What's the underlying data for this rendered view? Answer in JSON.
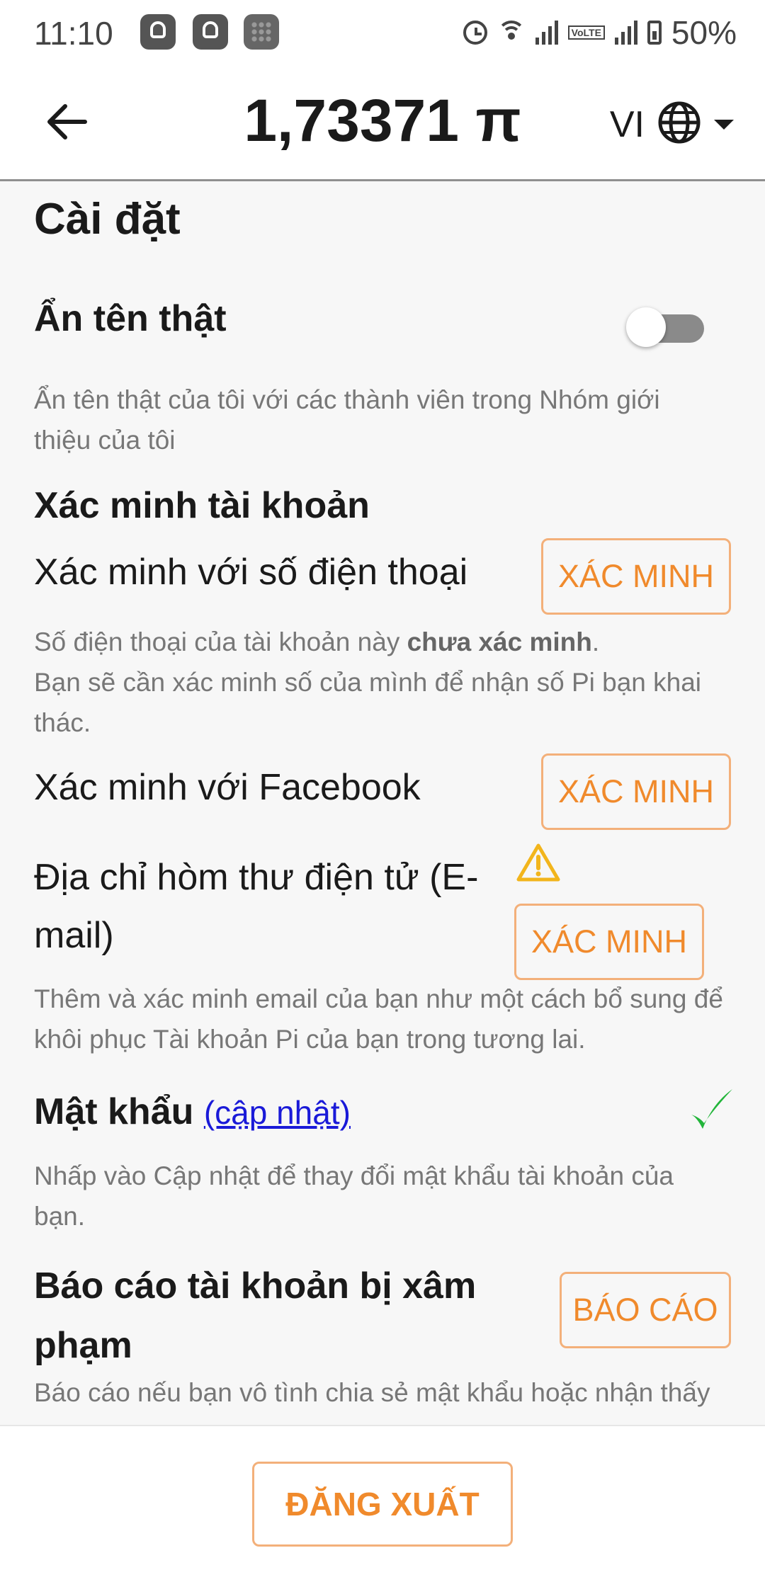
{
  "status_bar": {
    "time": "11:10",
    "network_badge": "VoLTE",
    "battery": "50%"
  },
  "header": {
    "balance": "1,73371 π",
    "language": "VI"
  },
  "settings": {
    "title": "Cài đặt",
    "hide_real_name": {
      "label": "Ẩn tên thật",
      "toggle_on": false,
      "description": "Ẩn tên thật của tôi với các thành viên trong Nhóm giới thiệu của tôi"
    },
    "verification": {
      "title": "Xác minh tài khoản",
      "phone": {
        "label": "Xác minh với số điện thoại",
        "button": "XÁC MINH",
        "desc_prefix": "Số điện thoại của tài khoản này ",
        "desc_bold": "chưa xác minh",
        "desc_suffix": ".",
        "desc_line2": "Bạn sẽ cần xác minh số của mình để nhận số Pi bạn khai thác."
      },
      "facebook": {
        "label": "Xác minh với Facebook",
        "button": "XÁC MINH"
      },
      "email": {
        "label_line1": "Địa chỉ hòm thư điện tử (E-",
        "label_line2": "mail)",
        "warning_icon": "warning-icon",
        "button": "XÁC MINH",
        "description": "Thêm và xác minh email của bạn như một cách bổ sung để khôi phục Tài khoản Pi của bạn trong tương lai."
      }
    },
    "password": {
      "label": "Mật khẩu",
      "update_link": "(cập nhật)",
      "status_icon": "checkmark-icon",
      "description": "Nhấp vào Cập nhật để thay đổi mật khẩu tài khoản của bạn."
    },
    "report": {
      "label_line1": "Báo cáo tài khoản bị xâm",
      "label_line2": "phạm",
      "button": "BÁO CÁO",
      "description": "Báo cáo nếu bạn vô tình chia sẻ mật khẩu hoặc nhận thấy"
    }
  },
  "footer": {
    "logout": "ĐĂNG XUẤT"
  },
  "colors": {
    "accent": "#f08a2c",
    "accent_border": "#f3b07a",
    "check_green": "#22b53a",
    "warning_yellow": "#f2b51c",
    "link_blue": "#1a1ad8"
  }
}
